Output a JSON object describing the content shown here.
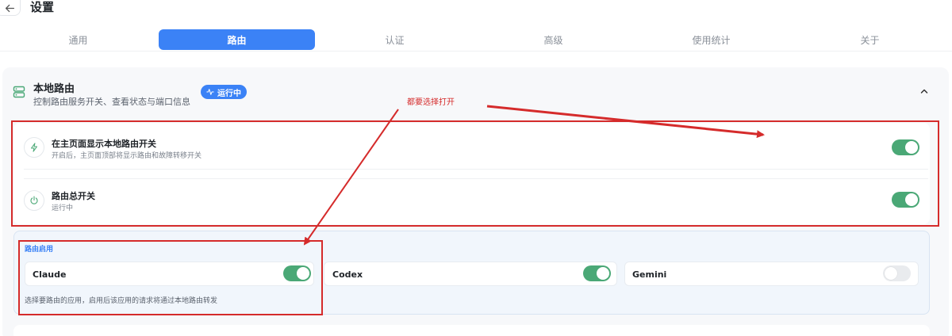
{
  "header": {
    "title": "设置",
    "back_icon": "arrow-left-icon"
  },
  "tabs": [
    {
      "label": "通用",
      "active": false
    },
    {
      "label": "路由",
      "active": true
    },
    {
      "label": "认证",
      "active": false
    },
    {
      "label": "高级",
      "active": false
    },
    {
      "label": "使用统计",
      "active": false
    },
    {
      "label": "关于",
      "active": false
    }
  ],
  "section": {
    "title": "本地路由",
    "subtitle": "控制路由服务开关、查看状态与端口信息",
    "status_badge": "运行中",
    "icon": "server-icon"
  },
  "rows": [
    {
      "title": "在主页面显示本地路由开关",
      "desc": "开启后，主页面顶部将显示路由和故障转移开关",
      "icon": "lightning-icon",
      "enabled": true
    },
    {
      "title": "路由总开关",
      "desc": "运行中",
      "icon": "power-icon",
      "enabled": true
    }
  ],
  "apps": {
    "label": "路由启用",
    "items": [
      {
        "name": "Claude",
        "enabled": true
      },
      {
        "name": "Codex",
        "enabled": true
      },
      {
        "name": "Gemini",
        "enabled": false
      }
    ],
    "hint": "选择要路由的应用，启用后该应用的请求将通过本地路由转发"
  },
  "annotation": {
    "text": "都要选择打开",
    "color": "#d52b2b"
  },
  "colors": {
    "accent": "#3b82f6",
    "toggle_on": "#4aa876",
    "annotation": "#d52b2b"
  }
}
